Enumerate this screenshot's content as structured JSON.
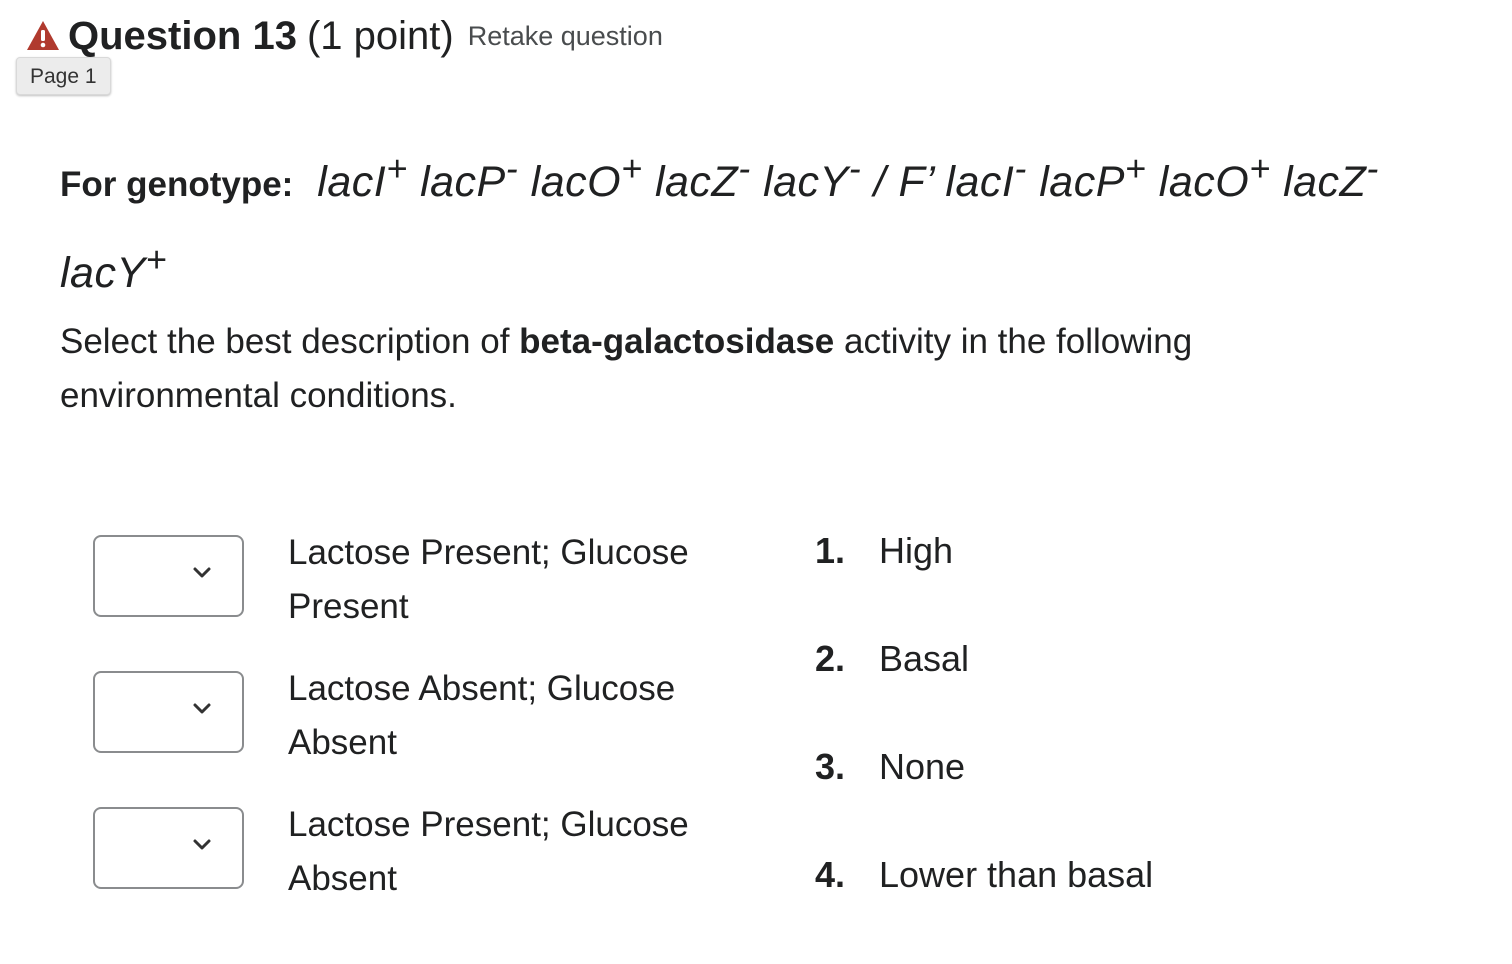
{
  "header": {
    "title": "Question 13",
    "points": "(1 point)",
    "retake": "Retake question",
    "warning_color": "#b03a2e"
  },
  "page_badge": "Page 1",
  "genotype": {
    "label": "For genotype:",
    "parts": {
      "g1": "lacI",
      "s1": "+",
      "g2": "lacP",
      "s2": "-",
      "g3": "lacO",
      "s3": "+",
      "g4": "lacZ",
      "s4": "-",
      "g5": "lacY",
      "s5": "-",
      "sep": "/ F’",
      "g6": "lacI",
      "s6": "-",
      "g7": "lacP",
      "s7": "+",
      "g8": "lacO",
      "s8": "+",
      "g9": "lacZ",
      "s9": "-",
      "g10": "lacY",
      "s10": "+"
    }
  },
  "prompt": {
    "before": "Select the best description of ",
    "bold": "beta-galactosidase",
    "after": " activity in the following environmental conditions."
  },
  "matches": [
    {
      "condition": "Lactose Present; Glucose Present",
      "selected": ""
    },
    {
      "condition": "Lactose Absent; Glucose Absent",
      "selected": ""
    },
    {
      "condition": "Lactose Present; Glucose Absent",
      "selected": ""
    }
  ],
  "choices": [
    {
      "num": "1.",
      "label": "High"
    },
    {
      "num": "2.",
      "label": "Basal"
    },
    {
      "num": "3.",
      "label": "None"
    },
    {
      "num": "4.",
      "label": "Lower than basal"
    }
  ]
}
